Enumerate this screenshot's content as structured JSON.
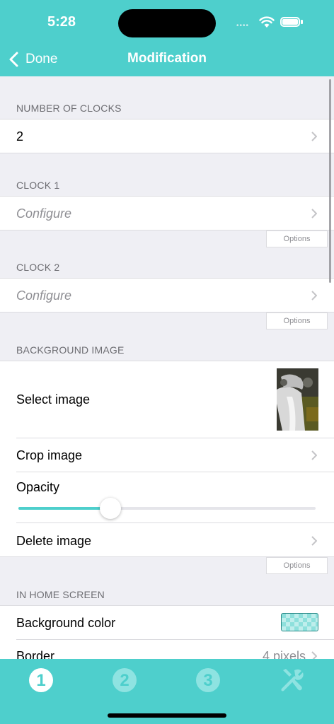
{
  "status": {
    "time": "5:28"
  },
  "nav": {
    "back_label": "Done",
    "title": "Modification"
  },
  "sections": {
    "number_of_clocks": {
      "header": "NUMBER OF CLOCKS",
      "value": "2"
    },
    "clock1": {
      "header": "CLOCK 1",
      "configure_label": "Configure",
      "options_label": "Options"
    },
    "clock2": {
      "header": "CLOCK 2",
      "configure_label": "Configure",
      "options_label": "Options"
    },
    "background_image": {
      "header": "BACKGROUND IMAGE",
      "select_label": "Select image",
      "crop_label": "Crop image",
      "opacity_label": "Opacity",
      "opacity_value": 0.31,
      "delete_label": "Delete image",
      "options_label": "Options"
    },
    "home_screen": {
      "header": "IN HOME SCREEN",
      "background_color_label": "Background color",
      "border_label": "Border",
      "border_value": "4 pixels"
    }
  },
  "tabs": [
    {
      "label": "1",
      "icon": "number-1-filled-icon",
      "selected": true
    },
    {
      "label": "2",
      "icon": "number-2-icon",
      "selected": false
    },
    {
      "label": "3",
      "icon": "number-3-icon",
      "selected": false
    },
    {
      "label": "",
      "icon": "tools-icon",
      "selected": false
    }
  ],
  "colors": {
    "accent": "#4ecfcc",
    "tab_selected": "#ffffff",
    "tab_unselected": "#8ee3e1"
  }
}
